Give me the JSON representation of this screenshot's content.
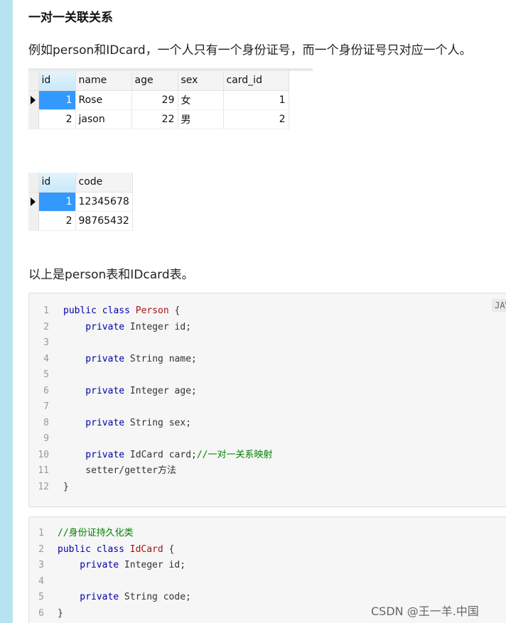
{
  "heading": "一对一关联关系",
  "intro": "例如person和IDcard，一个人只有一个身份证号，而一个身份证号只对应一个人。",
  "person_table": {
    "columns": [
      "id",
      "name",
      "age",
      "sex",
      "card_id"
    ],
    "rows": [
      [
        "1",
        "Rose",
        "29",
        "女",
        "1"
      ],
      [
        "2",
        "jason",
        "22",
        "男",
        "2"
      ]
    ]
  },
  "idcard_table": {
    "columns": [
      "id",
      "code"
    ],
    "rows": [
      [
        "1",
        "12345678"
      ],
      [
        "2",
        "98765432"
      ]
    ]
  },
  "summary": "以上是person表和IDcard表。",
  "code_block_1": {
    "language": "JAVA",
    "lines": [
      {
        "n": "1",
        "parts": [
          {
            "t": "public class ",
            "c": "kw"
          },
          {
            "t": "Person",
            "c": "cls"
          },
          {
            "t": " {",
            "c": "tx"
          }
        ]
      },
      {
        "n": "2",
        "parts": [
          {
            "t": "    private ",
            "c": "kw"
          },
          {
            "t": "Integer id;",
            "c": "tx"
          }
        ]
      },
      {
        "n": "3",
        "parts": []
      },
      {
        "n": "4",
        "parts": [
          {
            "t": "    private ",
            "c": "kw"
          },
          {
            "t": "String name;",
            "c": "tx"
          }
        ]
      },
      {
        "n": "5",
        "parts": []
      },
      {
        "n": "6",
        "parts": [
          {
            "t": "    private ",
            "c": "kw"
          },
          {
            "t": "Integer age;",
            "c": "tx"
          }
        ]
      },
      {
        "n": "7",
        "parts": []
      },
      {
        "n": "8",
        "parts": [
          {
            "t": "    private ",
            "c": "kw"
          },
          {
            "t": "String sex;",
            "c": "tx"
          }
        ]
      },
      {
        "n": "9",
        "parts": []
      },
      {
        "n": "10",
        "parts": [
          {
            "t": "    private ",
            "c": "kw"
          },
          {
            "t": "IdCard card;",
            "c": "tx"
          },
          {
            "t": "//一对一关系映射",
            "c": "cm"
          }
        ]
      },
      {
        "n": "11",
        "parts": [
          {
            "t": "    setter/getter方法",
            "c": "tx"
          }
        ]
      },
      {
        "n": "12",
        "parts": [
          {
            "t": "}",
            "c": "tx"
          }
        ]
      }
    ]
  },
  "code_block_2": {
    "lines": [
      {
        "n": "1",
        "parts": [
          {
            "t": "//身份证持久化类",
            "c": "cm"
          }
        ]
      },
      {
        "n": "2",
        "parts": [
          {
            "t": "public class ",
            "c": "kw"
          },
          {
            "t": "IdCard",
            "c": "cls"
          },
          {
            "t": " {",
            "c": "tx"
          }
        ]
      },
      {
        "n": "3",
        "parts": [
          {
            "t": "    private ",
            "c": "kw"
          },
          {
            "t": "Integer id;",
            "c": "tx"
          }
        ]
      },
      {
        "n": "4",
        "parts": []
      },
      {
        "n": "5",
        "parts": [
          {
            "t": "    private ",
            "c": "kw"
          },
          {
            "t": "String code;",
            "c": "tx"
          }
        ]
      },
      {
        "n": "6",
        "parts": [
          {
            "t": "}",
            "c": "tx"
          }
        ]
      }
    ]
  },
  "watermark": "CSDN @王一羊.中国",
  "colors": {
    "sidebar": "#b6e3ef",
    "selected_cell": "#3399ff",
    "keyword": "#0000aa",
    "class_name": "#a31515",
    "comment": "#008000"
  }
}
